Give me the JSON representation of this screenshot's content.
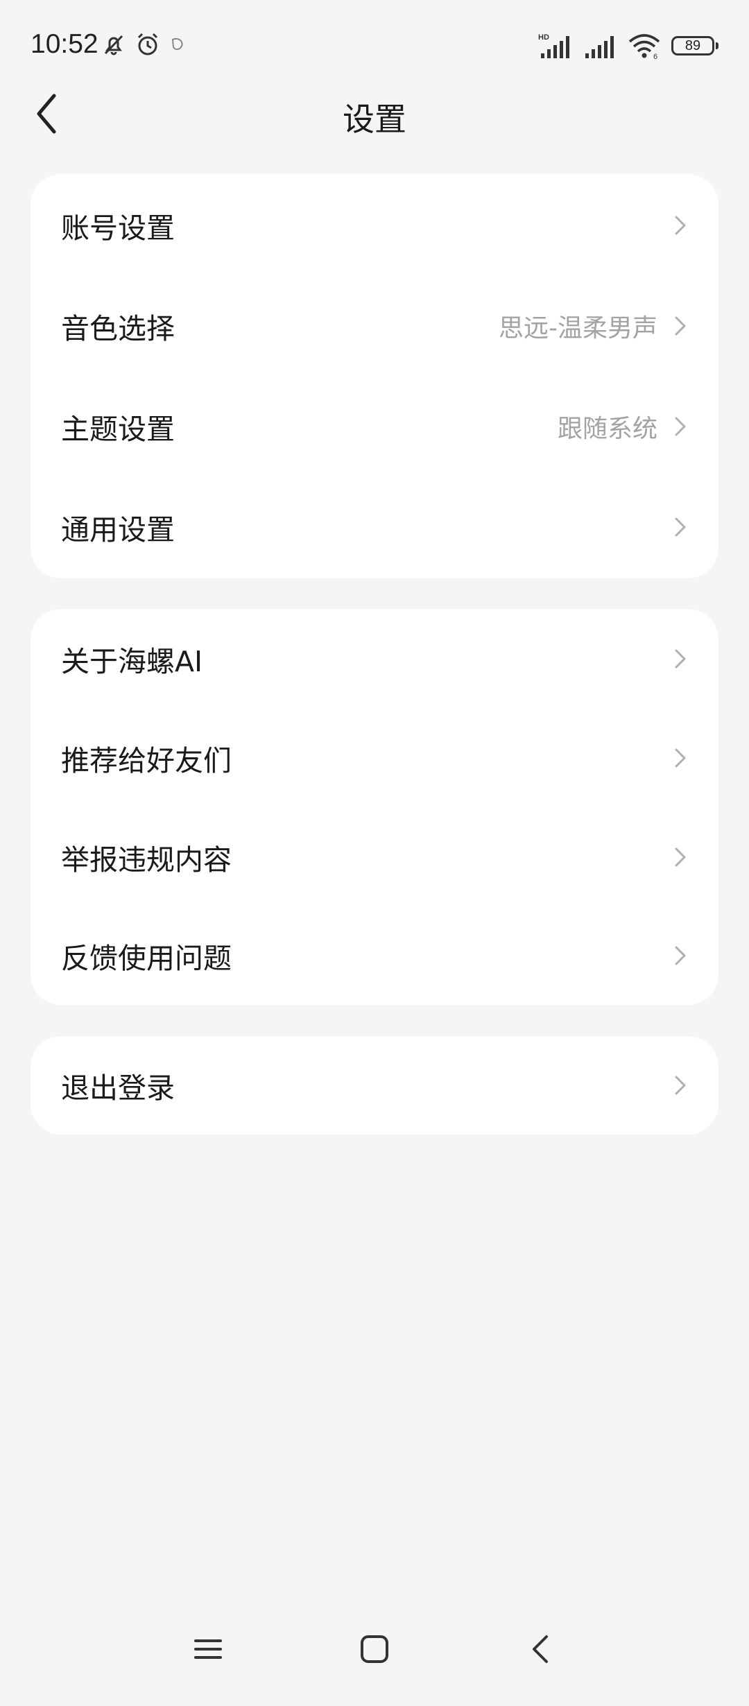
{
  "status_bar": {
    "time": "10:52",
    "battery": "89",
    "network_label": "HD"
  },
  "header": {
    "title": "设置"
  },
  "groups": [
    {
      "items": [
        {
          "label": "账号设置",
          "value": ""
        },
        {
          "label": "音色选择",
          "value": "思远-温柔男声"
        },
        {
          "label": "主题设置",
          "value": "跟随系统"
        },
        {
          "label": "通用设置",
          "value": ""
        }
      ]
    },
    {
      "items": [
        {
          "label": "关于海螺AI",
          "value": ""
        },
        {
          "label": "推荐给好友们",
          "value": ""
        },
        {
          "label": "举报违规内容",
          "value": ""
        },
        {
          "label": "反馈使用问题",
          "value": ""
        }
      ]
    },
    {
      "items": [
        {
          "label": "退出登录",
          "value": ""
        }
      ]
    }
  ],
  "colors": {
    "background": "#f4f5f7",
    "card": "#ffffff",
    "secondary_text": "#a3a3a3",
    "chevron": "#b0b0b0"
  },
  "icons": [
    "bell-off-icon",
    "alarm-icon",
    "notification-icon",
    "signal-icon",
    "wifi-icon",
    "battery-icon",
    "back-icon",
    "chevron-right-icon",
    "menu-icon",
    "home-icon",
    "back-nav-icon"
  ]
}
